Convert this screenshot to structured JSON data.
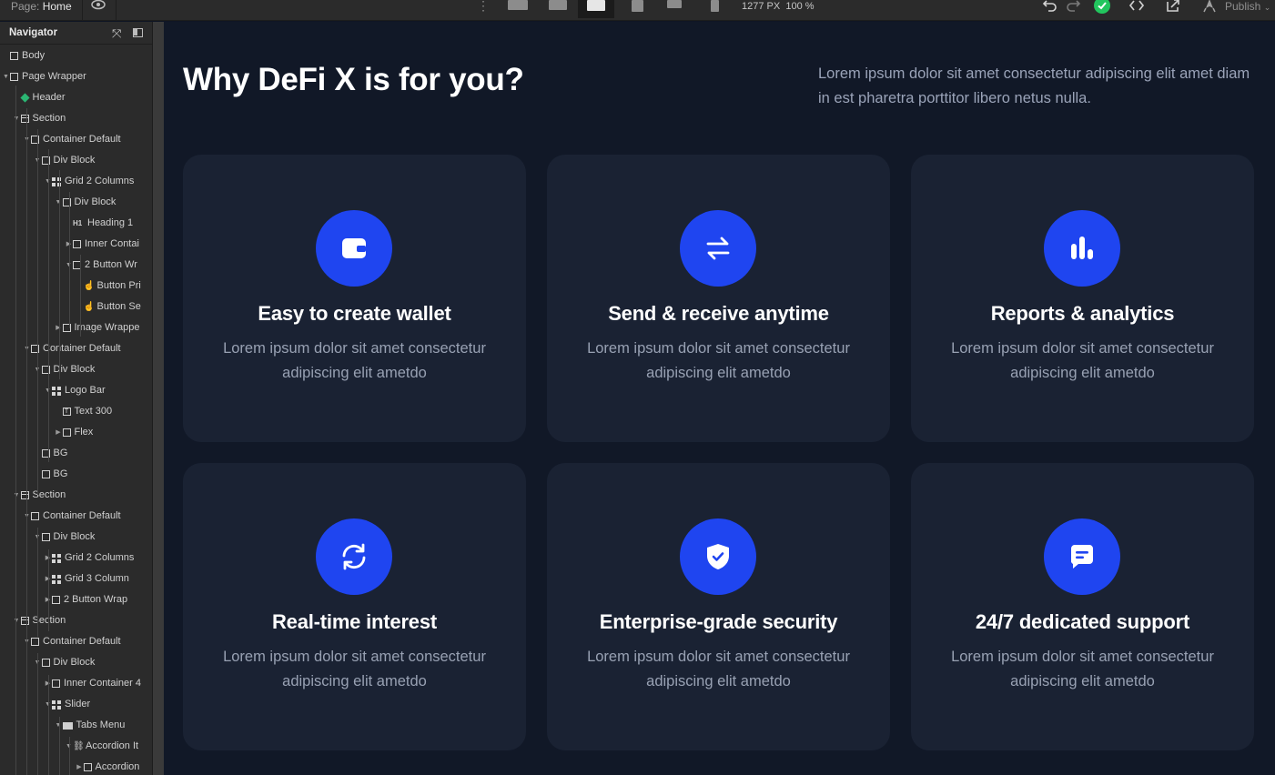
{
  "toolbar": {
    "page_prefix": "Page:",
    "page_name": "Home",
    "width_readout": "1277 PX",
    "zoom_readout": "100 %",
    "publish_label": "Publish"
  },
  "navigator": {
    "title": "Navigator",
    "items": [
      {
        "label": "Body",
        "icon": "box"
      },
      {
        "label": "Page Wrapper",
        "icon": "box"
      },
      {
        "label": "Header",
        "icon": "component"
      },
      {
        "label": "Section",
        "icon": "section"
      },
      {
        "label": "Container Default",
        "icon": "box"
      },
      {
        "label": "Div Block",
        "icon": "box"
      },
      {
        "label": "Grid 2 Columns",
        "icon": "grid"
      },
      {
        "label": "Div Block",
        "icon": "box"
      },
      {
        "label": "Heading 1",
        "icon": "heading"
      },
      {
        "label": "Inner Contai",
        "icon": "box"
      },
      {
        "label": "2 Button Wr",
        "icon": "box"
      },
      {
        "label": "Button Pri",
        "icon": "button"
      },
      {
        "label": "Button Se",
        "icon": "button"
      },
      {
        "label": "Image Wrappe",
        "icon": "box"
      },
      {
        "label": "Container Default",
        "icon": "box"
      },
      {
        "label": "Div Block",
        "icon": "box"
      },
      {
        "label": "Logo Bar",
        "icon": "grid"
      },
      {
        "label": "Text 300",
        "icon": "text"
      },
      {
        "label": "Flex",
        "icon": "box"
      },
      {
        "label": "BG",
        "icon": "box"
      },
      {
        "label": "BG",
        "icon": "box"
      },
      {
        "label": "Section",
        "icon": "section"
      },
      {
        "label": "Container Default",
        "icon": "container"
      },
      {
        "label": "Div Block",
        "icon": "box"
      },
      {
        "label": "Grid 2 Columns",
        "icon": "grid"
      },
      {
        "label": "Grid 3 Column",
        "icon": "grid"
      },
      {
        "label": "2 Button Wrap",
        "icon": "box"
      },
      {
        "label": "Section",
        "icon": "section"
      },
      {
        "label": "Container Default",
        "icon": "container"
      },
      {
        "label": "Div Block",
        "icon": "box"
      },
      {
        "label": "Inner Container 4",
        "icon": "box"
      },
      {
        "label": "Slider",
        "icon": "grid"
      },
      {
        "label": "Tabs Menu",
        "icon": "tabs"
      },
      {
        "label": "Accordion It",
        "icon": "link"
      },
      {
        "label": "Accordion",
        "icon": "box"
      }
    ]
  },
  "content": {
    "heading": "Why DeFi X is for you?",
    "intro": "Lorem ipsum dolor sit amet consectetur adipiscing elit amet diam in est pharetra porttitor libero netus nulla.",
    "accent_color": "#1f45f0",
    "cards": [
      {
        "icon": "wallet-icon",
        "title": "Easy to create wallet",
        "text": "Lorem ipsum dolor sit amet consectetur adipiscing elit ametdo"
      },
      {
        "icon": "transfer-arrows-icon",
        "title": "Send & receive anytime",
        "text": "Lorem ipsum dolor sit amet consectetur adipiscing elit ametdo"
      },
      {
        "icon": "bar-chart-icon",
        "title": "Reports & analytics",
        "text": "Lorem ipsum dolor sit amet consectetur adipiscing elit ametdo"
      },
      {
        "icon": "refresh-icon",
        "title": "Real-time interest",
        "text": "Lorem ipsum dolor sit amet consectetur adipiscing elit ametdo"
      },
      {
        "icon": "shield-check-icon",
        "title": "Enterprise-grade security",
        "text": "Lorem ipsum dolor sit amet consectetur adipiscing elit ametdo"
      },
      {
        "icon": "chat-bubble-icon",
        "title": "24/7 dedicated support",
        "text": "Lorem ipsum dolor sit amet consectetur adipiscing elit ametdo"
      }
    ]
  }
}
